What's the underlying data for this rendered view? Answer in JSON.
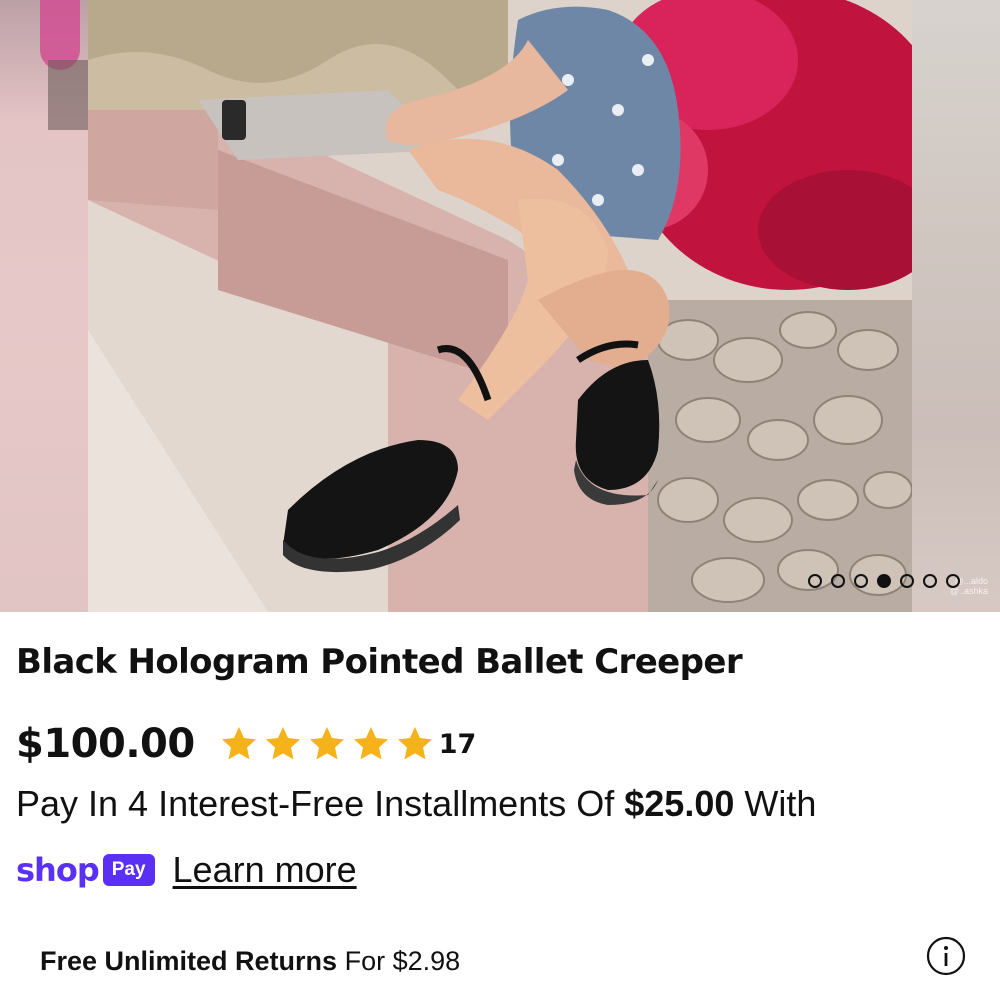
{
  "carousel": {
    "total_slides": 7,
    "active_index": 4,
    "watermark": "@...aldo @..ashka"
  },
  "product": {
    "title": "Black Hologram Pointed Ballet Creeper",
    "price": "$100.00",
    "rating": 5,
    "review_count": "17",
    "star_color": "#f5b21a"
  },
  "installments": {
    "prefix": "Pay In 4 Interest-Free Installments Of",
    "amount": "$25.00",
    "suffix": "With"
  },
  "shop_pay": {
    "brand_word": "shop",
    "badge": "Pay",
    "brand_color": "#5a31f4",
    "link": "Learn more"
  },
  "returns": {
    "label": "Free Unlimited Returns",
    "price_text": "For $2.98",
    "icon": "info-icon"
  }
}
